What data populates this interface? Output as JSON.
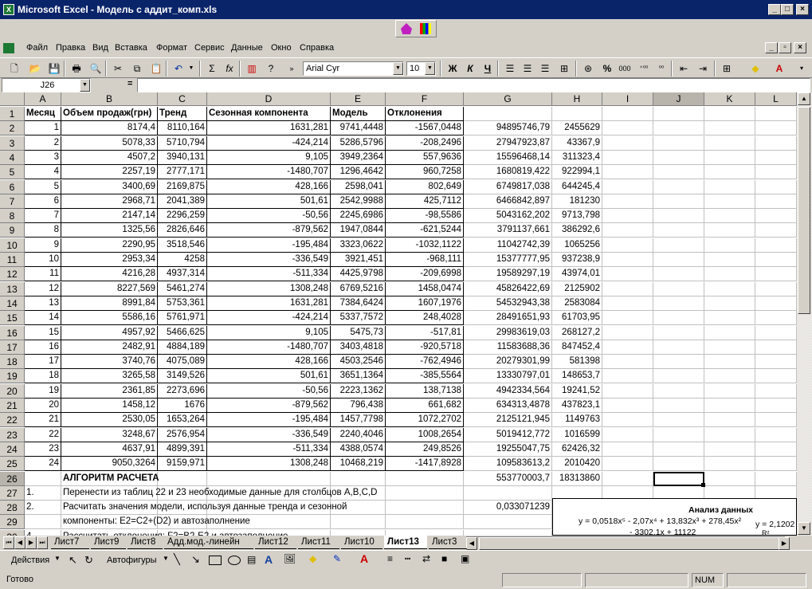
{
  "window": {
    "title": "Microsoft Excel - Модель с аддит_комп.xls"
  },
  "menu": [
    "Файл",
    "Правка",
    "Вид",
    "Вставка",
    "Формат",
    "Сервис",
    "Данные",
    "Окно",
    "Справка"
  ],
  "toolbar": {
    "font": "Arial Cyr",
    "size": "10",
    "bold": "Ж",
    "italic": "К",
    "underline": "Ч",
    "percent": "%",
    "thousands": "000",
    "sigma": "Σ",
    "fx": "fx"
  },
  "formula_bar": {
    "name_box": "J26",
    "eq": "=",
    "value": ""
  },
  "columns": [
    "A",
    "B",
    "C",
    "D",
    "E",
    "F",
    "G",
    "H",
    "I",
    "J",
    "K",
    "L"
  ],
  "rows": [
    [
      "Месяц",
      "Объем продаж(грн)",
      "Тренд",
      "Сезонная компонента",
      "Модель",
      "Отклонения",
      "",
      ""
    ],
    [
      "1",
      "8174,4",
      "8110,164",
      "1631,281",
      "9741,4448",
      "-1567,0448",
      "94895746,79",
      "2455629"
    ],
    [
      "2",
      "5078,33",
      "5710,794",
      "-424,214",
      "5286,5796",
      "-208,2496",
      "27947923,87",
      "43367,9"
    ],
    [
      "3",
      "4507,2",
      "3940,131",
      "9,105",
      "3949,2364",
      "557,9636",
      "15596468,14",
      "311323,4"
    ],
    [
      "4",
      "2257,19",
      "2777,171",
      "-1480,707",
      "1296,4642",
      "960,7258",
      "1680819,422",
      "922994,1"
    ],
    [
      "5",
      "3400,69",
      "2169,875",
      "428,166",
      "2598,041",
      "802,649",
      "6749817,038",
      "644245,4"
    ],
    [
      "6",
      "2968,71",
      "2041,389",
      "501,61",
      "2542,9988",
      "425,7112",
      "6466842,897",
      "181230"
    ],
    [
      "7",
      "2147,14",
      "2296,259",
      "-50,56",
      "2245,6986",
      "-98,5586",
      "5043162,202",
      "9713,798"
    ],
    [
      "8",
      "1325,56",
      "2826,646",
      "-879,562",
      "1947,0844",
      "-621,5244",
      "3791137,661",
      "386292,6"
    ],
    [
      "9",
      "2290,95",
      "3518,546",
      "-195,484",
      "3323,0622",
      "-1032,1122",
      "11042742,39",
      "1065256"
    ],
    [
      "10",
      "2953,34",
      "4258",
      "-336,549",
      "3921,451",
      "-968,111",
      "15377777,95",
      "937238,9"
    ],
    [
      "11",
      "4216,28",
      "4937,314",
      "-511,334",
      "4425,9798",
      "-209,6998",
      "19589297,19",
      "43974,01"
    ],
    [
      "12",
      "8227,569",
      "5461,274",
      "1308,248",
      "6769,5216",
      "1458,0474",
      "45826422,69",
      "2125902"
    ],
    [
      "13",
      "8991,84",
      "5753,361",
      "1631,281",
      "7384,6424",
      "1607,1976",
      "54532943,38",
      "2583084"
    ],
    [
      "14",
      "5586,16",
      "5761,971",
      "-424,214",
      "5337,7572",
      "248,4028",
      "28491651,93",
      "61703,95"
    ],
    [
      "15",
      "4957,92",
      "5466,625",
      "9,105",
      "5475,73",
      "-517,81",
      "29983619,03",
      "268127,2"
    ],
    [
      "16",
      "2482,91",
      "4884,189",
      "-1480,707",
      "3403,4818",
      "-920,5718",
      "11583688,36",
      "847452,4"
    ],
    [
      "17",
      "3740,76",
      "4075,089",
      "428,166",
      "4503,2546",
      "-762,4946",
      "20279301,99",
      "581398"
    ],
    [
      "18",
      "3265,58",
      "3149,526",
      "501,61",
      "3651,1364",
      "-385,5564",
      "13330797,01",
      "148653,7"
    ],
    [
      "19",
      "2361,85",
      "2273,696",
      "-50,56",
      "2223,1362",
      "138,7138",
      "4942334,564",
      "19241,52"
    ],
    [
      "20",
      "1458,12",
      "1676",
      "-879,562",
      "796,438",
      "661,682",
      "634313,4878",
      "437823,1"
    ],
    [
      "21",
      "2530,05",
      "1653,264",
      "-195,484",
      "1457,7798",
      "1072,2702",
      "2125121,945",
      "1149763"
    ],
    [
      "22",
      "3248,67",
      "2576,954",
      "-336,549",
      "2240,4046",
      "1008,2654",
      "5019412,772",
      "1016599"
    ],
    [
      "23",
      "4637,91",
      "4899,391",
      "-511,334",
      "4388,0574",
      "249,8526",
      "19255047,75",
      "62426,32"
    ],
    [
      "24",
      "9050,3264",
      "9159,971",
      "1308,248",
      "10468,219",
      "-1417,8928",
      "109583613,2",
      "2010420"
    ]
  ],
  "row26": {
    "title": "АЛГОРИТМ РАСЧЕТА",
    "g": "553770003,7",
    "h": "18313860"
  },
  "steps": [
    {
      "num": "1.",
      "text": "Перенести из таблиц 22 и 23 необходимые данные для столбцов A,B,C,D"
    },
    {
      "num": "2.",
      "text": "Расчитать значения модели, используя данные тренда и сезонной",
      "g": "0,033071239"
    },
    {
      "num": "",
      "text": "компоненты: E2=C2+(D2) и автозаполнение"
    },
    {
      "num": "4.",
      "text": "Рассчитать отклонения: F2=B2-E2 и автозаполнение"
    }
  ],
  "chart": {
    "title": "Анализ данных",
    "eq1": "y = 0,0518x⁵ - 2,07x⁴ + 13,832x³ + 278,45x²",
    "eq1b": "- 3302,1x + 11122",
    "eq2": "y = 2,1202",
    "r2": "R²"
  },
  "sheet_tabs": [
    "Лист7",
    "Лист9",
    "Лист8",
    "Адд.мод.-линейн",
    "Лист12",
    "Лист11",
    "Лист10",
    "Лист13",
    "Лист3"
  ],
  "active_tab": "Лист13",
  "draw": {
    "actions": "Действия",
    "autoshapes": "Автофигуры"
  },
  "status": {
    "ready": "Готово",
    "num": "NUM"
  }
}
